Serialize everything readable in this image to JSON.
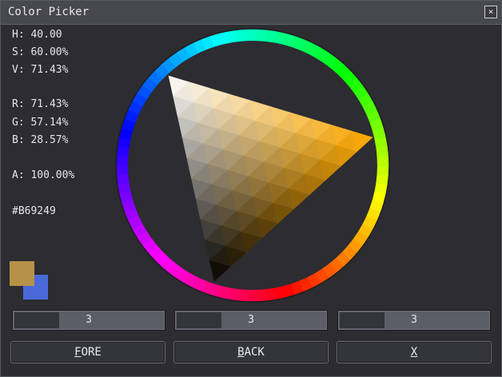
{
  "window": {
    "title": "Color Picker",
    "close_symbol": "×"
  },
  "info": {
    "hue": "H: 40.00",
    "saturation": "S: 60.00%",
    "value": "V: 71.43%",
    "red": "R: 71.43%",
    "green": "G: 57.14%",
    "blue": "B: 28.57%",
    "alpha": "A: 100.00%",
    "hex": "#B69249"
  },
  "swatches": {
    "fore_color": "#B69249",
    "back_color": "#4A69D8"
  },
  "sliders": [
    {
      "value": "3",
      "level": 0.3
    },
    {
      "value": "3",
      "level": 0.3
    },
    {
      "value": "3",
      "level": 0.3
    }
  ],
  "buttons": {
    "fore": {
      "mnemonic": "F",
      "rest": "ORE"
    },
    "back": {
      "mnemonic": "B",
      "rest": "ACK"
    },
    "x": {
      "mnemonic": "X",
      "rest": ""
    }
  },
  "colors": {
    "window_bg": "#2C2C31",
    "titlebar_bg": "#48484F"
  }
}
